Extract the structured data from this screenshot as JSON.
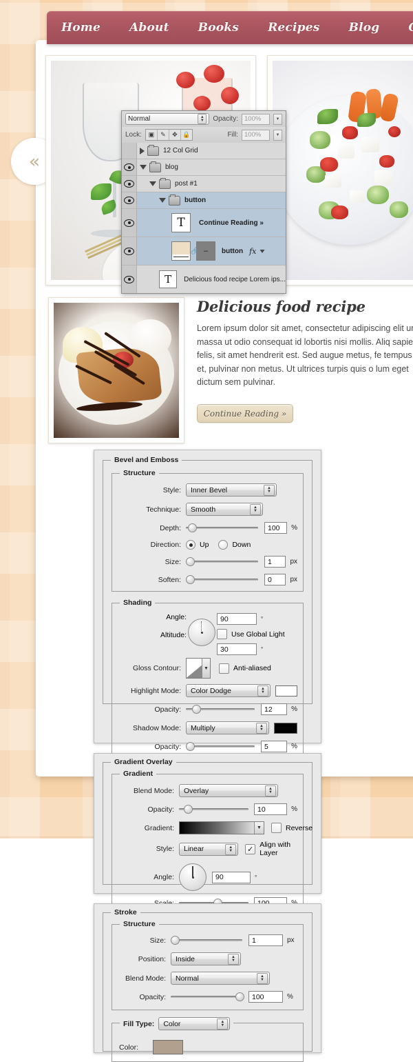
{
  "nav": {
    "items": [
      {
        "label": "Home"
      },
      {
        "label": "About"
      },
      {
        "label": "Books"
      },
      {
        "label": "Recipes"
      },
      {
        "label": "Blog"
      },
      {
        "label": "Cor"
      }
    ]
  },
  "collapse": {
    "icon": "double-chevron-left",
    "glyph": "«"
  },
  "post": {
    "title": "Delicious food recipe",
    "body": "Lorem ipsum dolor sit amet, consectetur adipiscing elit unt massa ut odio consequat id lobortis nisi mollis. Aliq sapien felis, sit amet hendrerit est. Sed augue metus, fe tempus et, pulvinar non metus. Ut ultrices turpis quis o lum eget dictum sem pulvinar.",
    "button": "Continue Reading »"
  },
  "layers_panel": {
    "blend_mode": "Normal",
    "opacity_label": "Opacity:",
    "opacity_value": "100%",
    "lock_label": "Lock:",
    "fill_label": "Fill:",
    "fill_value": "100%",
    "lock_buttons": [
      "lock-transparent-icon",
      "lock-image-icon",
      "lock-position-icon",
      "lock-all-icon"
    ],
    "rows": [
      {
        "name": "12 Col Grid",
        "visible": false,
        "selected": false,
        "kind": "group",
        "expanded": false,
        "indent": 0,
        "bold": false
      },
      {
        "name": "blog",
        "visible": true,
        "selected": false,
        "kind": "group",
        "expanded": true,
        "indent": 0,
        "bold": false
      },
      {
        "name": "post #1",
        "visible": true,
        "selected": false,
        "kind": "group",
        "expanded": true,
        "indent": 1,
        "bold": false
      },
      {
        "name": "button",
        "visible": true,
        "selected": true,
        "kind": "group",
        "expanded": true,
        "indent": 2,
        "bold": true
      },
      {
        "name": "Continue Reading »",
        "visible": true,
        "selected": true,
        "kind": "text",
        "indent": 3,
        "bold": true
      },
      {
        "name": "button",
        "visible": true,
        "selected": true,
        "kind": "shape",
        "indent": 3,
        "bold": true,
        "fx": "fx"
      },
      {
        "name": "Delicious food recipe Lorem ips...",
        "visible": true,
        "selected": false,
        "kind": "text",
        "indent": 2,
        "bold": false
      }
    ]
  },
  "bevel": {
    "title": "Bevel and Emboss",
    "structure_title": "Structure",
    "shading_title": "Shading",
    "style_label": "Style:",
    "style_value": "Inner Bevel",
    "technique_label": "Technique:",
    "technique_value": "Smooth",
    "depth_label": "Depth:",
    "depth_value": "100",
    "depth_unit": "%",
    "direction_label": "Direction:",
    "direction_up": "Up",
    "direction_down": "Down",
    "direction_selected": "Up",
    "size_label": "Size:",
    "size_value": "1",
    "size_unit": "px",
    "soften_label": "Soften:",
    "soften_value": "0",
    "soften_unit": "px",
    "angle_label": "Angle:",
    "angle_value": "90",
    "angle_unit": "°",
    "use_global_light": "Use Global Light",
    "use_global_light_checked": false,
    "altitude_label": "Altitude:",
    "altitude_value": "30",
    "altitude_unit": "°",
    "gloss_contour_label": "Gloss Contour:",
    "anti_aliased": "Anti-aliased",
    "anti_aliased_checked": false,
    "highlight_mode_label": "Highlight Mode:",
    "highlight_mode_value": "Color Dodge",
    "highlight_color": "#ffffff",
    "highlight_opacity_label": "Opacity:",
    "highlight_opacity_value": "12",
    "highlight_opacity_unit": "%",
    "shadow_mode_label": "Shadow Mode:",
    "shadow_mode_value": "Multiply",
    "shadow_color": "#000000",
    "shadow_opacity_label": "Opacity:",
    "shadow_opacity_value": "5",
    "shadow_opacity_unit": "%"
  },
  "gradient": {
    "title": "Gradient Overlay",
    "group_title": "Gradient",
    "blend_mode_label": "Blend Mode:",
    "blend_mode_value": "Overlay",
    "opacity_label": "Opacity:",
    "opacity_value": "10",
    "opacity_unit": "%",
    "gradient_label": "Gradient:",
    "reverse_label": "Reverse",
    "reverse_checked": false,
    "style_label": "Style:",
    "style_value": "Linear",
    "align_label": "Align with Layer",
    "align_checked": true,
    "angle_label": "Angle:",
    "angle_value": "90",
    "angle_unit": "°",
    "scale_label": "Scale:",
    "scale_value": "100",
    "scale_unit": "%"
  },
  "stroke": {
    "title": "Stroke",
    "structure_title": "Structure",
    "size_label": "Size:",
    "size_value": "1",
    "size_unit": "px",
    "position_label": "Position:",
    "position_value": "Inside",
    "blend_mode_label": "Blend Mode:",
    "blend_mode_value": "Normal",
    "opacity_label": "Opacity:",
    "opacity_value": "100",
    "opacity_unit": "%",
    "fill_type_label": "Fill Type:",
    "fill_type_value": "Color",
    "color_label": "Color:",
    "color_value": "#b2a08e"
  },
  "photos": [
    {
      "alt": "wine-glass-and-strawberries-photo"
    },
    {
      "alt": "fresh-salad-with-feta-photo"
    },
    {
      "alt": "chocolate-crepe-dessert-photo"
    }
  ],
  "colors": {
    "nav_bg": "#ab5660",
    "plaid": "#f6d3a9",
    "button_bg": "#e2d3b6",
    "panel_bg": "#e9e9e9"
  }
}
